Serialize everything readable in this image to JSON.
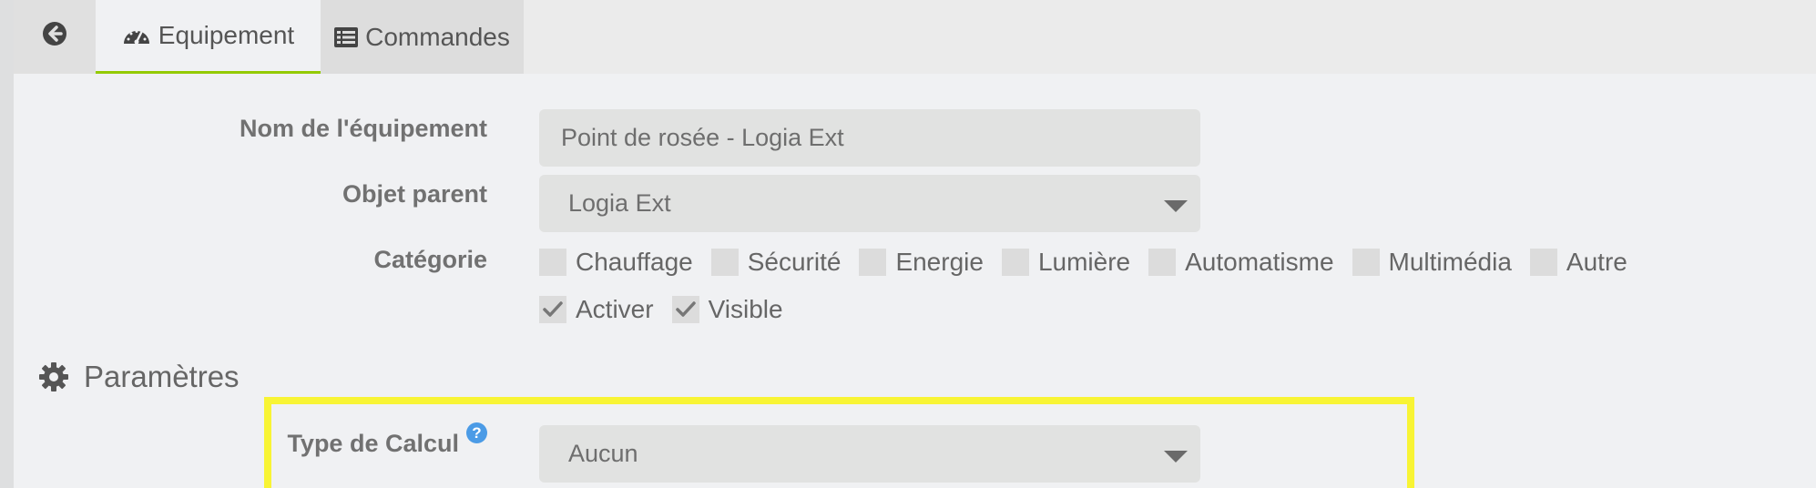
{
  "tabs": {
    "back_icon": "arrow-circle-left-icon",
    "equipement_label": "Equipement",
    "equipement_icon": "dashboard-gauge-icon",
    "commandes_label": "Commandes",
    "commandes_icon": "list-icon"
  },
  "form": {
    "name_label": "Nom de l'équipement",
    "name_value": "Point de rosée - Logia Ext",
    "parent_label": "Objet parent",
    "parent_value": "Logia Ext",
    "category_label": "Catégorie",
    "categories": [
      "Chauffage",
      "Sécurité",
      "Energie",
      "Lumière",
      "Automatisme",
      "Multimédia",
      "Autre"
    ],
    "activer_label": "Activer",
    "activer_checked": true,
    "visible_label": "Visible",
    "visible_checked": true
  },
  "parametres": {
    "title": "Paramètres",
    "icon": "gear-icon",
    "type_calcul_label": "Type de Calcul",
    "help_icon": "question-circle-icon",
    "help_glyph": "?",
    "type_calcul_value": "Aucun"
  },
  "colors": {
    "active_tab_underline": "#94ca02",
    "highlight": "#f8f434",
    "help_icon": "#4b9be6"
  }
}
